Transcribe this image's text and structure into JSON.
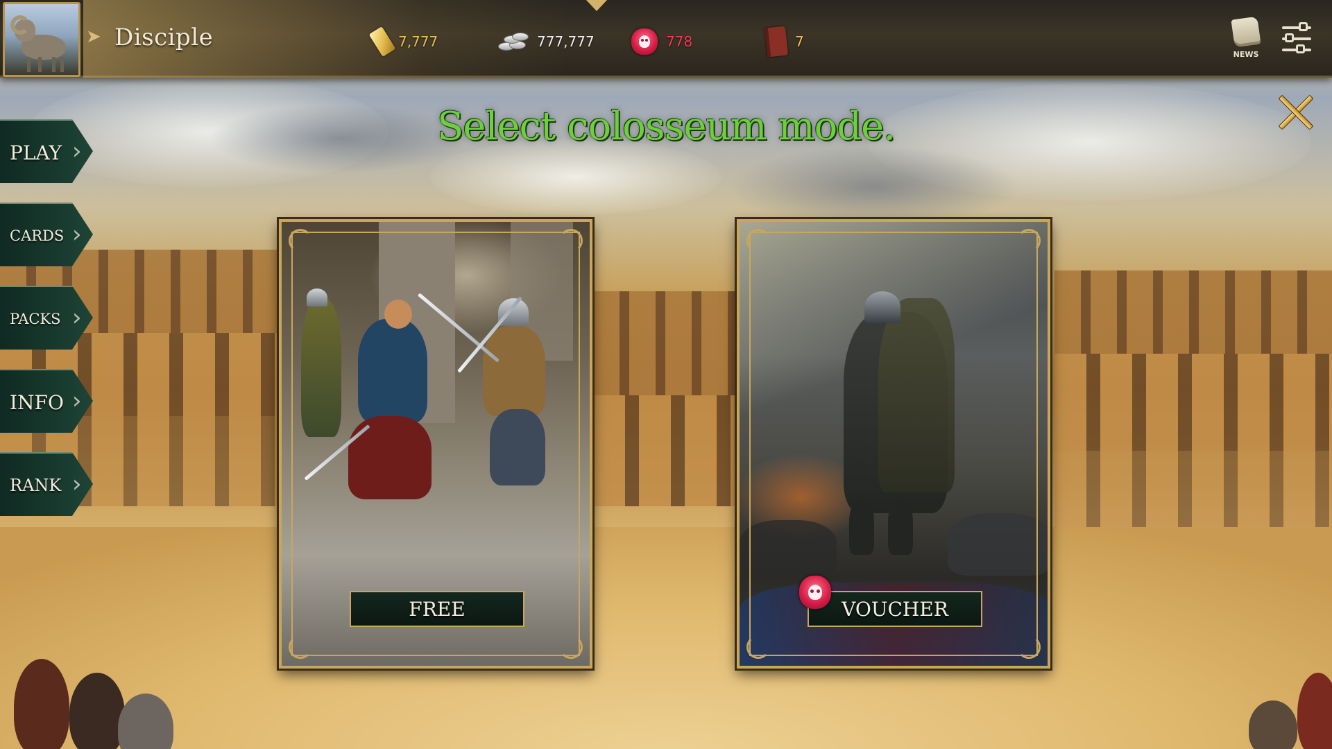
{
  "topbar": {
    "rank_title": "Disciple",
    "currencies": [
      {
        "name": "gold",
        "icon": "gold-bar-icon",
        "value": "7,777",
        "color": "#e8c05a"
      },
      {
        "name": "silver",
        "icon": "silver-coins-icon",
        "value": "777,777",
        "color": "#eeeeee"
      },
      {
        "name": "voucher",
        "icon": "voucher-mask-icon",
        "value": "778",
        "color": "#f03a55"
      },
      {
        "name": "book",
        "icon": "red-book-icon",
        "value": "7",
        "color": "#e8c05a"
      }
    ],
    "news_label": "NEWS"
  },
  "heading": "Select colosseum mode.",
  "sidenav": {
    "items": [
      {
        "id": "play",
        "label": "PLAY"
      },
      {
        "id": "cards",
        "label": "CARDS"
      },
      {
        "id": "packs",
        "label": "PACKS"
      },
      {
        "id": "info",
        "label": "INFO"
      },
      {
        "id": "rank",
        "label": "RANK"
      }
    ]
  },
  "modes": [
    {
      "id": "free",
      "label": "FREE"
    },
    {
      "id": "voucher",
      "label": "VOUCHER"
    }
  ],
  "colors": {
    "heading_green": "#6ecf3e",
    "frame_gold": "#c9a65e",
    "nav_green": "#18392e"
  }
}
